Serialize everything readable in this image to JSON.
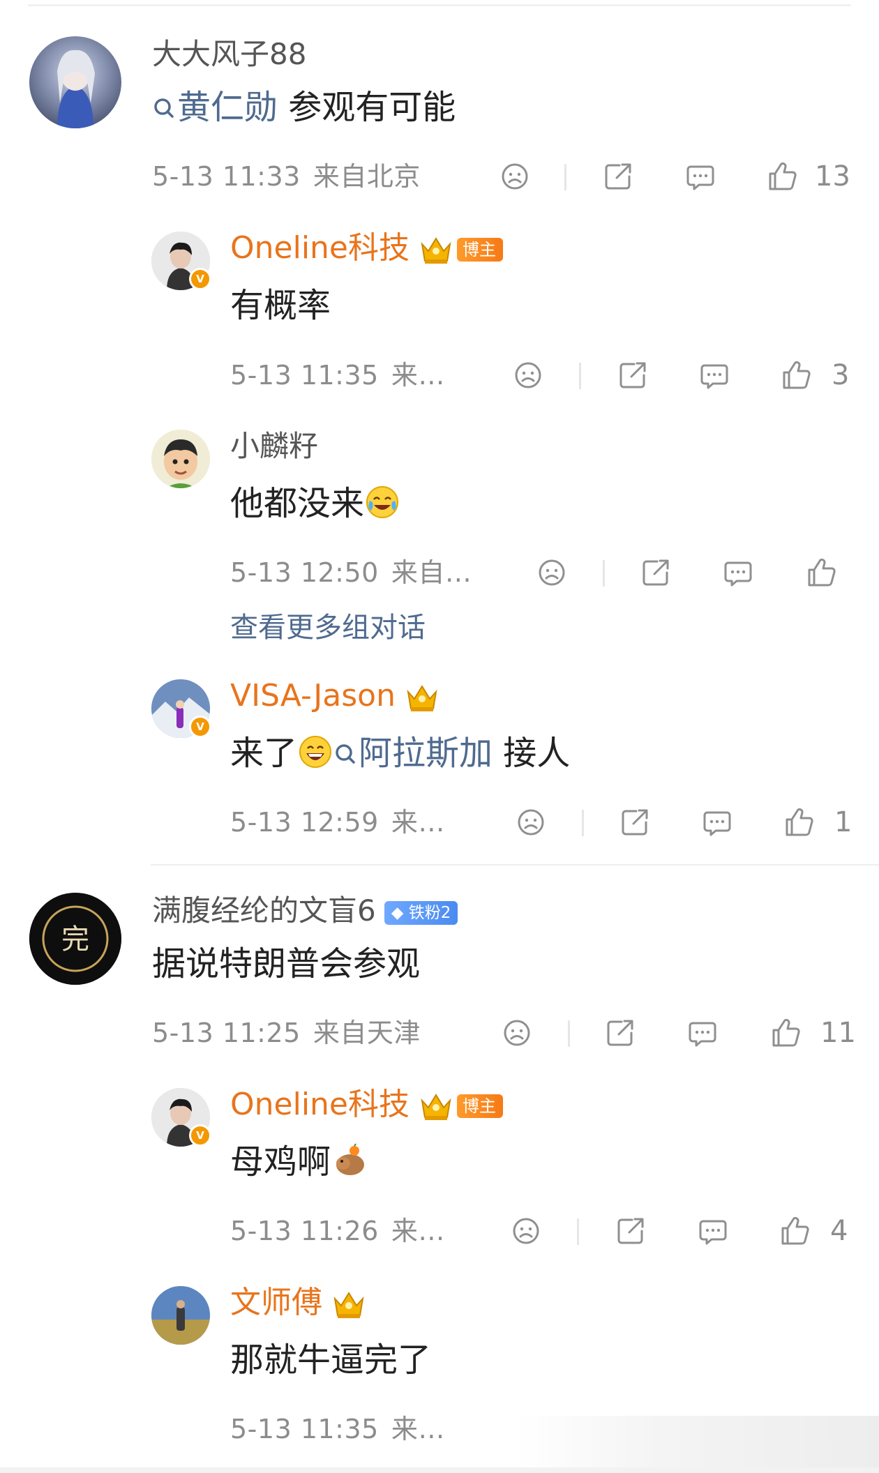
{
  "comments": [
    {
      "user": "大大风子88",
      "content_link": "黄仁勋",
      "content_text": " 参观有可能",
      "time": "5-13 11:33",
      "location": "来自北京",
      "likes": "13",
      "replies": [
        {
          "user": "Oneline科技",
          "badge": "博主",
          "content": "有概率",
          "time": "5-13 11:35",
          "location": "来…",
          "likes": "3"
        },
        {
          "user": "小麟籽",
          "content": "他都没来",
          "time": "5-13 12:50",
          "location": "来自…",
          "likes": ""
        }
      ],
      "more_label": "查看更多组对话",
      "reply_after": {
        "user": "VISA-Jason",
        "content_a": "来了",
        "content_link": "阿拉斯加",
        "content_b": " 接人",
        "time": "5-13 12:59",
        "location": "来…",
        "likes": "1"
      }
    },
    {
      "user": "满腹经纶的文盲6",
      "fan_badge": "铁粉2",
      "avatar_text": "完",
      "content": "据说特朗普会参观",
      "time": "5-13 11:25",
      "location": "来自天津",
      "likes": "11",
      "replies": [
        {
          "user": "Oneline科技",
          "badge": "博主",
          "content": "母鸡啊",
          "time": "5-13 11:26",
          "location": "来…",
          "likes": "4"
        },
        {
          "user": "文师傅",
          "content": "那就牛逼完了",
          "time": "5-13 11:35",
          "location": "来…"
        }
      ]
    }
  ],
  "icons": [
    "search-icon",
    "sad-icon",
    "share-icon",
    "comment-icon",
    "like-icon",
    "crown-icon",
    "verified-icon"
  ],
  "colors": {
    "name_orange": "#e8741c",
    "link_blue": "#4f6a8f",
    "meta_gray": "#8c8c8c"
  }
}
